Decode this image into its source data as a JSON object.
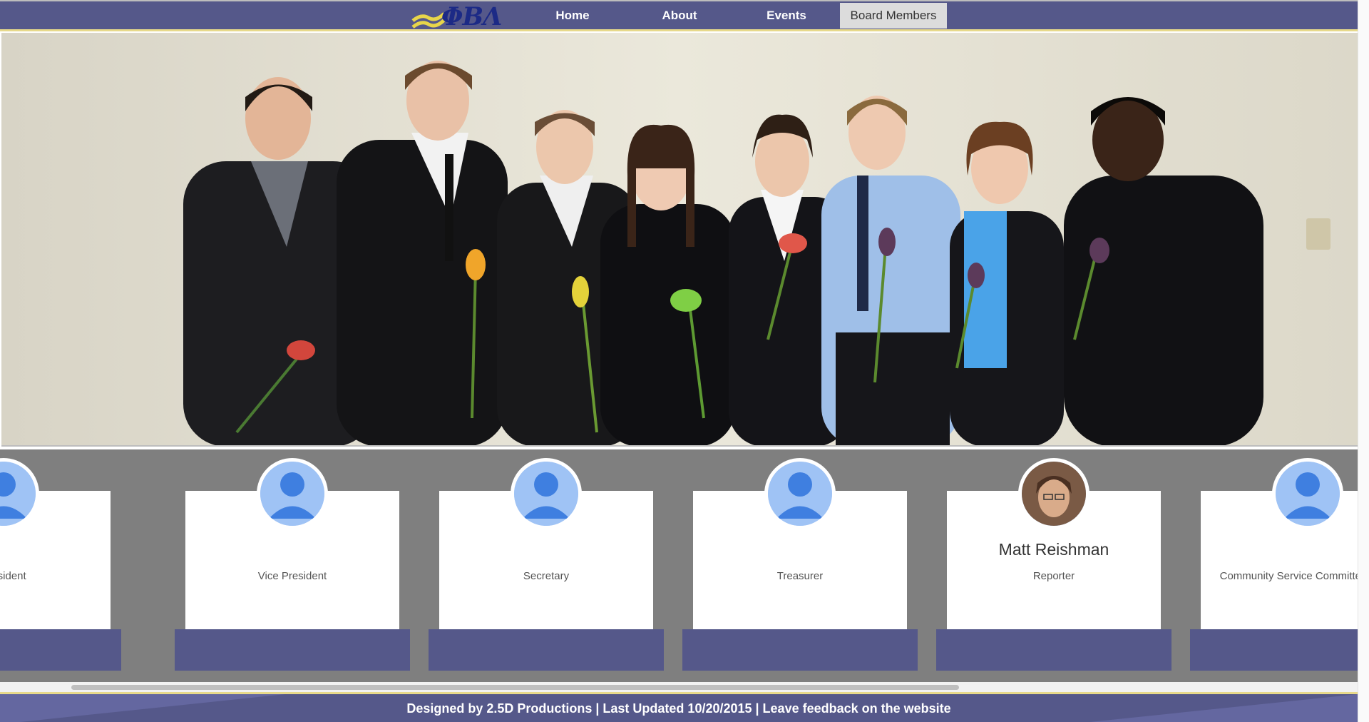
{
  "header": {
    "logo_text": "ΦΒΛ",
    "nav": [
      {
        "label": "Home",
        "active": false
      },
      {
        "label": "About",
        "active": false
      },
      {
        "label": "Events",
        "active": false
      },
      {
        "label": "Board Members",
        "active": true
      }
    ]
  },
  "members": [
    {
      "name": "",
      "role": "President",
      "avatar": "person-placeholder-icon"
    },
    {
      "name": "",
      "role": "Vice President",
      "avatar": "person-placeholder-icon"
    },
    {
      "name": "",
      "role": "Secretary",
      "avatar": "person-placeholder-icon"
    },
    {
      "name": "",
      "role": "Treasurer",
      "avatar": "person-placeholder-icon"
    },
    {
      "name": "Matt Reishman",
      "role": "Reporter",
      "avatar": "member-photo"
    },
    {
      "name": "",
      "role": "Community Service Committee Chair",
      "avatar": "person-placeholder-icon"
    }
  ],
  "footer": {
    "text": "Designed by 2.5D Productions | Last Updated 10/20/2015 | Leave feedback on the website"
  },
  "colors": {
    "brand_purple": "#55588a",
    "accent_gold": "#e7d98b",
    "band_gray": "#7f7f7f",
    "avatar_blue": "#9fc3f5",
    "avatar_figure": "#3f7fe0"
  }
}
